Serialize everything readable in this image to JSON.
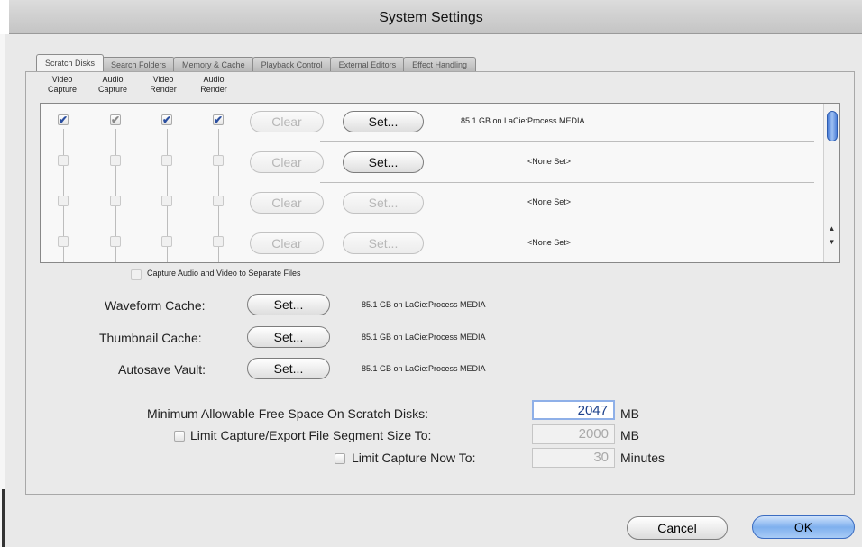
{
  "window": {
    "title": "System Settings"
  },
  "tabs": [
    {
      "label": "Scratch Disks",
      "active": true
    },
    {
      "label": "Search Folders"
    },
    {
      "label": "Memory & Cache"
    },
    {
      "label": "Playback Control"
    },
    {
      "label": "External Editors"
    },
    {
      "label": "Effect Handling"
    }
  ],
  "columns": [
    "Video Capture",
    "Audio Capture",
    "Video Render",
    "Audio Render"
  ],
  "column_lines": [
    [
      "Video",
      "Capture"
    ],
    [
      "Audio",
      "Capture"
    ],
    [
      "Video",
      "Render"
    ],
    [
      "Audio",
      "Render"
    ]
  ],
  "scratch_disks": [
    {
      "video_capture": true,
      "audio_capture": true,
      "video_render": true,
      "audio_render": true,
      "clear_label": "Clear",
      "set_label": "Set...",
      "info": "85.1 GB on LaCie:Process MEDIA"
    },
    {
      "video_capture": false,
      "audio_capture": false,
      "video_render": false,
      "audio_render": false,
      "clear_label": "Clear",
      "set_label": "Set...",
      "info": "<None Set>"
    },
    {
      "video_capture": false,
      "audio_capture": false,
      "video_render": false,
      "audio_render": false,
      "clear_label": "Clear",
      "set_label": "Set...",
      "info": "<None Set>"
    },
    {
      "video_capture": false,
      "audio_capture": false,
      "video_render": false,
      "audio_render": false,
      "clear_label": "Clear",
      "set_label": "Set...",
      "info": "<None Set>"
    }
  ],
  "separate_files": {
    "label": "Capture Audio and Video to Separate Files",
    "checked": false
  },
  "caches": [
    {
      "label": "Waveform Cache:",
      "button": "Set...",
      "info": "85.1 GB on LaCie:Process MEDIA"
    },
    {
      "label": "Thumbnail Cache:",
      "button": "Set...",
      "info": "85.1 GB on LaCie:Process MEDIA"
    },
    {
      "label": "Autosave Vault:",
      "button": "Set...",
      "info": "85.1 GB on LaCie:Process MEDIA"
    }
  ],
  "limits": {
    "min_free": {
      "label": "Minimum Allowable Free Space On Scratch Disks:",
      "value": "2047",
      "unit": "MB"
    },
    "segment": {
      "label": "Limit Capture/Export File Segment Size To:",
      "value": "2000",
      "unit": "MB",
      "checked": false
    },
    "capture_now": {
      "label": "Limit Capture Now To:",
      "value": "30",
      "unit": "Minutes",
      "checked": false
    }
  },
  "footer": {
    "cancel": "Cancel",
    "ok": "OK"
  },
  "colors": {
    "accent": "#4d80d8",
    "check": "#2b4fa0"
  }
}
